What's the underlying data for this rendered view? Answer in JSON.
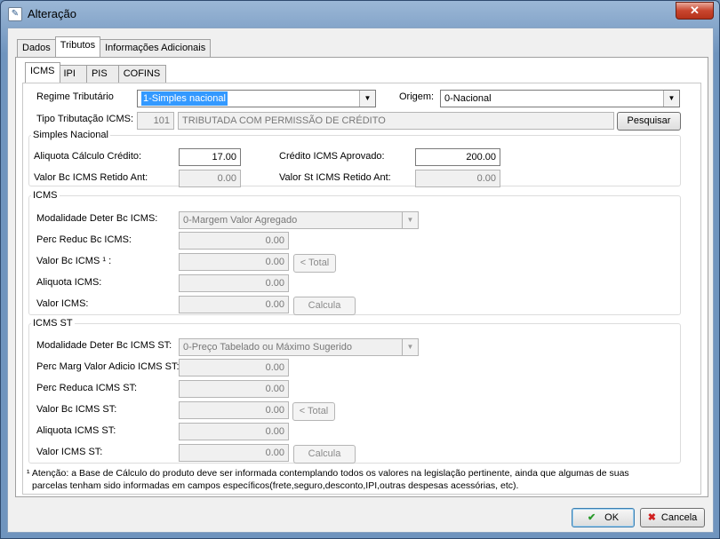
{
  "window": {
    "title": "Alteração"
  },
  "main_tabs": [
    "Dados",
    "Tributos",
    "Informações Adicionais"
  ],
  "sub_tabs": [
    "ICMS",
    "IPI",
    "PIS",
    "COFINS"
  ],
  "header": {
    "regime_label": "Regime Tributário",
    "regime_value": "1-Simples nacional",
    "origem_label": "Origem:",
    "origem_value": "0-Nacional",
    "tipo_label": "Tipo Tributação ICMS:",
    "tipo_code": "101",
    "tipo_desc": "TRIBUTADA COM PERMISSÃO DE CRÉDITO",
    "pesquisar": "Pesquisar"
  },
  "simples": {
    "title": "Simples Nacional",
    "aliq_label": "Aliquota Cálculo Crédito:",
    "aliq_value": "17.00",
    "credito_label": "Crédito ICMS Aprovado:",
    "credito_value": "200.00",
    "bc_ret_label": "Valor Bc ICMS Retido Ant:",
    "bc_ret_value": "0.00",
    "st_ret_label": "Valor St ICMS Retido Ant:",
    "st_ret_value": "0.00"
  },
  "icms": {
    "title": "ICMS",
    "modalidade_label": "Modalidade Deter Bc ICMS:",
    "modalidade_value": "0-Margem Valor Agregado",
    "perc_reduc_label": "Perc Reduc Bc ICMS:",
    "perc_reduc_value": "0.00",
    "valor_bc_label": "Valor Bc ICMS ¹ :",
    "valor_bc_value": "0.00",
    "total_btn": "< Total",
    "aliq_label": "Aliquota ICMS:",
    "aliq_value": "0.00",
    "valor_label": "Valor ICMS:",
    "valor_value": "0.00",
    "calcula_btn": "Calcula"
  },
  "icms_st": {
    "title": "ICMS ST",
    "modalidade_label": "Modalidade Deter Bc ICMS ST:",
    "modalidade_value": "0-Preço Tabelado ou Máximo Sugerido",
    "perc_marg_label": "Perc Marg Valor Adicio ICMS ST:",
    "perc_marg_value": "0.00",
    "perc_reduca_label": "Perc Reduca ICMS ST:",
    "perc_reduca_value": "0.00",
    "valor_bc_label": "Valor Bc ICMS ST:",
    "valor_bc_value": "0.00",
    "total_btn": "< Total",
    "aliq_label": "Aliquota ICMS ST:",
    "aliq_value": "0.00",
    "valor_label": "Valor ICMS ST:",
    "valor_value": "0.00",
    "calcula_btn": "Calcula"
  },
  "footnote": {
    "line1": "¹ Atenção: a Base de Cálculo do produto deve ser informada contemplando todos os valores na legislação pertinente, ainda que algumas de suas",
    "line2": "parcelas tenham sido informadas em campos específicos(frete,seguro,desconto,IPI,outras despesas acessórias, etc)."
  },
  "footer": {
    "ok": "OK",
    "cancel": "Cancela"
  }
}
